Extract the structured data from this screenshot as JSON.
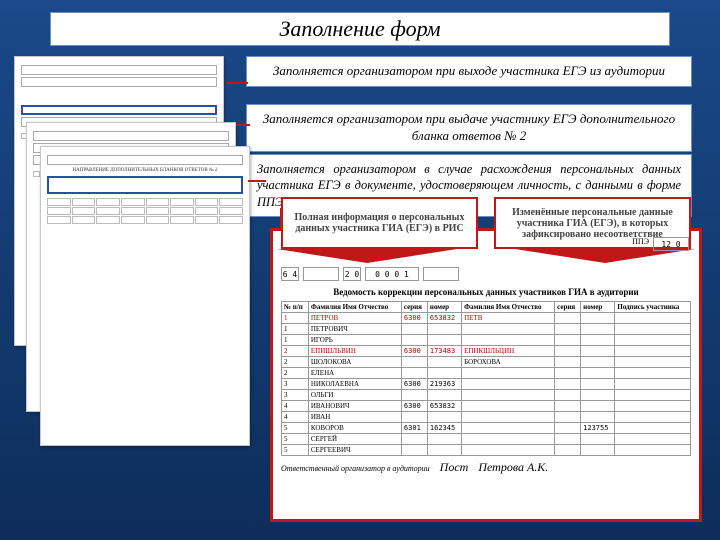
{
  "title": "Заполнение форм",
  "callouts": {
    "c1": "Заполняется организатором при выходе участника ЕГЭ из аудитории",
    "c2": "Заполняется организатором при выдаче участнику ЕГЭ дополнительного бланка ответов № 2",
    "c3": "Заполняется организатором в случае расхождения персональных данных участника ЕГЭ в документе, удостоверяющем личность, с данными в форме ППЭ – 05-02"
  },
  "doc3_caption": "НАПРАВЛЕНИЕ ДОПОЛНИТЕЛЬНЫХ БЛАНКОВ ОТВЕТОВ № 2",
  "banners": {
    "left": "Полная информация о персональных данных участника ГИА (ЕГЭ) в РИС",
    "right": "Изменённые персональные данные участника ГИА (ЕГЭ), в которых зафиксировано несоответствие"
  },
  "codes_row": {
    "a": "6 4",
    "b": "",
    "c": "2 0",
    "d": "0 0 0 1",
    "e": ""
  },
  "ppe": {
    "label": "ППЭ",
    "value": "12 0"
  },
  "vedomost_title": "Ведомость коррекции персональных данных участников ГИА в аудитории",
  "table": {
    "headers_left": [
      "№ п/п",
      "Фамилия Имя Отчество",
      "серия",
      "номер"
    ],
    "headers_right": [
      "Фамилия Имя Отчество",
      "серия",
      "номер",
      "Подпись участника"
    ],
    "rows": [
      {
        "n": "1",
        "lfio": "ПЕТРОВ",
        "ls": "6300",
        "ln": "653832",
        "rfio": "ПЕТВ",
        "rs": "",
        "rn": "",
        "strike": true
      },
      {
        "n": "1",
        "lfio": "ПЕТРОВИЧ",
        "ls": "",
        "ln": "",
        "rfio": "",
        "rs": "",
        "rn": ""
      },
      {
        "n": "1",
        "lfio": "ИГОРЬ",
        "ls": "",
        "ln": "",
        "rfio": "",
        "rs": "",
        "rn": ""
      },
      {
        "n": "2",
        "lfio": "ЕПИШЛЬВИН",
        "ls": "6300",
        "ln": "173483",
        "rfio": "ЕПИКШЛЬЦИН",
        "rs": "",
        "rn": "",
        "strike": true
      },
      {
        "n": "2",
        "lfio": "ШОЛОКОВА",
        "ls": "",
        "ln": "",
        "rfio": "БОРОХОВА",
        "rs": "",
        "rn": ""
      },
      {
        "n": "2",
        "lfio": "ЕЛЕНА",
        "ls": "",
        "ln": "",
        "rfio": "",
        "rs": "",
        "rn": ""
      },
      {
        "n": "3",
        "lfio": "НИКОЛАЕВНА",
        "ls": "6300",
        "ln": "219363",
        "rfio": "",
        "rs": "",
        "rn": ""
      },
      {
        "n": "3",
        "lfio": "ОЛЬГИ",
        "ls": "",
        "ln": "",
        "rfio": "",
        "rs": "",
        "rn": ""
      },
      {
        "n": "4",
        "lfio": "ИВАНОВИЧ",
        "ls": "6300",
        "ln": "653832",
        "rfio": "",
        "rs": "",
        "rn": ""
      },
      {
        "n": "4",
        "lfio": "ИВАН",
        "ls": "",
        "ln": "",
        "rfio": "",
        "rs": "",
        "rn": ""
      },
      {
        "n": "5",
        "lfio": "КОВОРОВ",
        "ls": "6301",
        "ln": "162345",
        "rfio": "",
        "rs": "",
        "rn": "123755"
      },
      {
        "n": "5",
        "lfio": "СЕРГЕЙ",
        "ls": "",
        "ln": "",
        "rfio": "",
        "rs": "",
        "rn": ""
      },
      {
        "n": "5",
        "lfio": "СЕРГЕЕВИЧ",
        "ls": "",
        "ln": "",
        "rfio": "",
        "rs": "",
        "rn": ""
      }
    ]
  },
  "footer": {
    "label": "Ответственный организатор в аудитории",
    "sig1": "Пост",
    "sig2": "Петрова А.К."
  }
}
